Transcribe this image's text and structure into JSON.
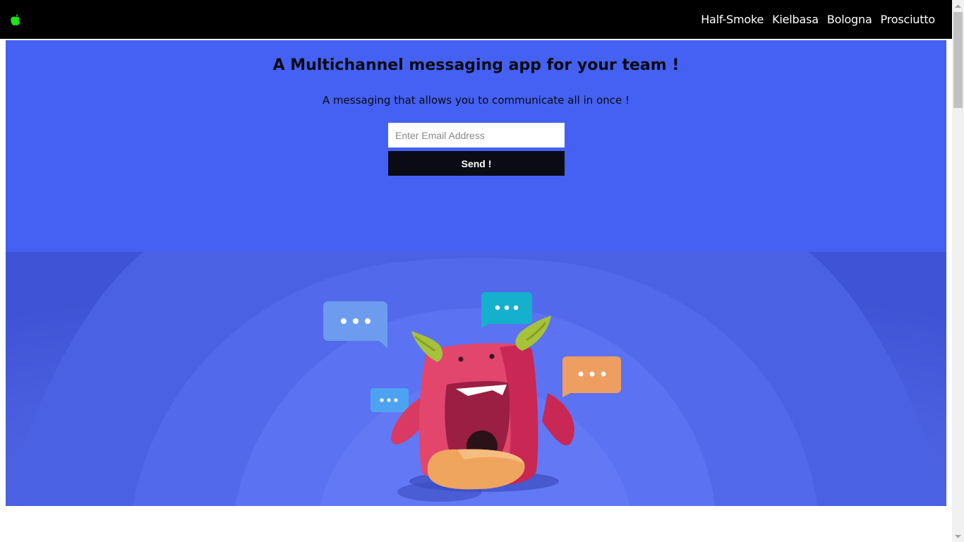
{
  "nav": {
    "logo_icon": "apple-icon",
    "logo_color": "#22e01a",
    "links": [
      {
        "label": "Half-Smoke"
      },
      {
        "label": "Kielbasa"
      },
      {
        "label": "Bologna"
      },
      {
        "label": "Prosciutto"
      }
    ]
  },
  "hero": {
    "title": "A Multichannel messaging app for your team !",
    "subtitle": "A messaging that allows you to communicate all in once !",
    "email_placeholder": "Enter Email Address",
    "send_label": "Send !",
    "background": "#4461f3"
  },
  "illustration": {
    "subject": "monster-mascot",
    "bubbles": [
      "chat-bubble-blue",
      "chat-bubble-teal",
      "chat-bubble-orange",
      "chat-bubble-small-blue"
    ]
  }
}
